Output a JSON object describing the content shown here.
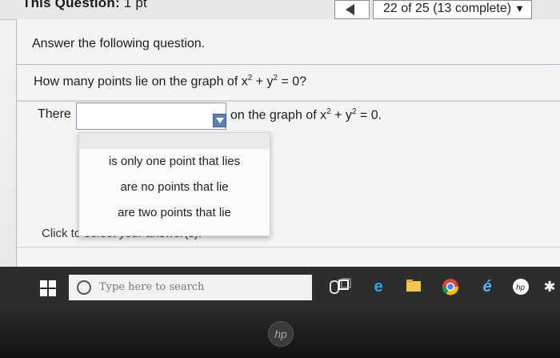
{
  "header": {
    "title": "This Question:",
    "points": "1 pt",
    "progress": "22 of 25 (13 complete)"
  },
  "question": {
    "instruction": "Answer the following question.",
    "prompt_before": "How many points lie on the graph of x",
    "prompt_mid": " + y",
    "prompt_after": " = 0?",
    "answer_prefix": "There",
    "answer_suffix_before": "on the graph of x",
    "answer_suffix_mid": " + y",
    "answer_suffix_after": " = 0.",
    "exponent": "2"
  },
  "dropdown": {
    "selected": "",
    "options": [
      "is only one point that lies",
      "are no points that lie",
      "are two points that lie"
    ]
  },
  "hint": "Click to select your answer(s).",
  "taskbar": {
    "search_placeholder": "Type here to search",
    "icons": [
      "windows-icon",
      "cortana-circle-icon",
      "mic-icon",
      "task-view-icon",
      "edge-icon",
      "file-explorer-icon",
      "chrome-icon",
      "ie-icon",
      "hp-icon",
      "settings-icon"
    ]
  },
  "bezel_logo": "hp"
}
